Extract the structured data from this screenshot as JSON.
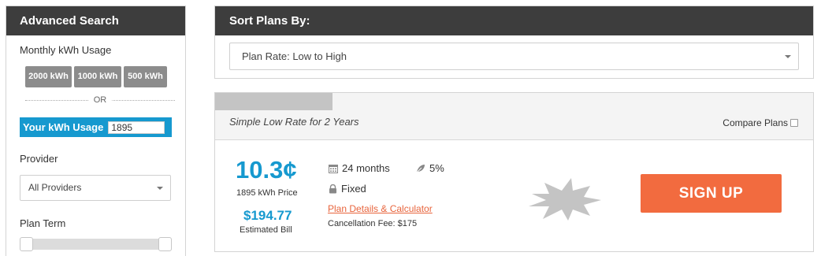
{
  "sidebar": {
    "title": "Advanced Search",
    "monthly_usage_label": "Monthly kWh Usage",
    "usage_buttons": [
      "2000 kWh",
      "1000 kWh",
      "500 kWh"
    ],
    "or_text": "OR",
    "your_usage_label": "Your kWh Usage",
    "your_usage_value": "1895",
    "provider_label": "Provider",
    "provider_selected": "All Providers",
    "plan_term_label": "Plan Term"
  },
  "sort": {
    "title": "Sort Plans By:",
    "selected": "Plan Rate: Low to High"
  },
  "plan": {
    "tagline": "Simple Low Rate for 2 Years",
    "compare_label": "Compare Plans",
    "compare_checked": false,
    "rate": "10.3¢",
    "rate_label": "1895 kWh Price",
    "bill": "$194.77",
    "bill_label": "Estimated Bill",
    "term": "24 months",
    "renewable": "5%",
    "rate_type": "Fixed",
    "details_link": "Plan Details & Calculator",
    "cancellation_fee": "Cancellation Fee: $175",
    "signup_label": "SIGN UP"
  },
  "colors": {
    "header_bg": "#3d3d3d",
    "accent_blue": "#1699cf",
    "cta_orange": "#f26b3f",
    "usage_button_gray": "#8c8c8c",
    "badge_gray": "#c4c4c4"
  },
  "icons": [
    "calendar-icon",
    "leaf-icon",
    "lock-icon",
    "chevron-down-icon",
    "badge-starburst-icon"
  ]
}
